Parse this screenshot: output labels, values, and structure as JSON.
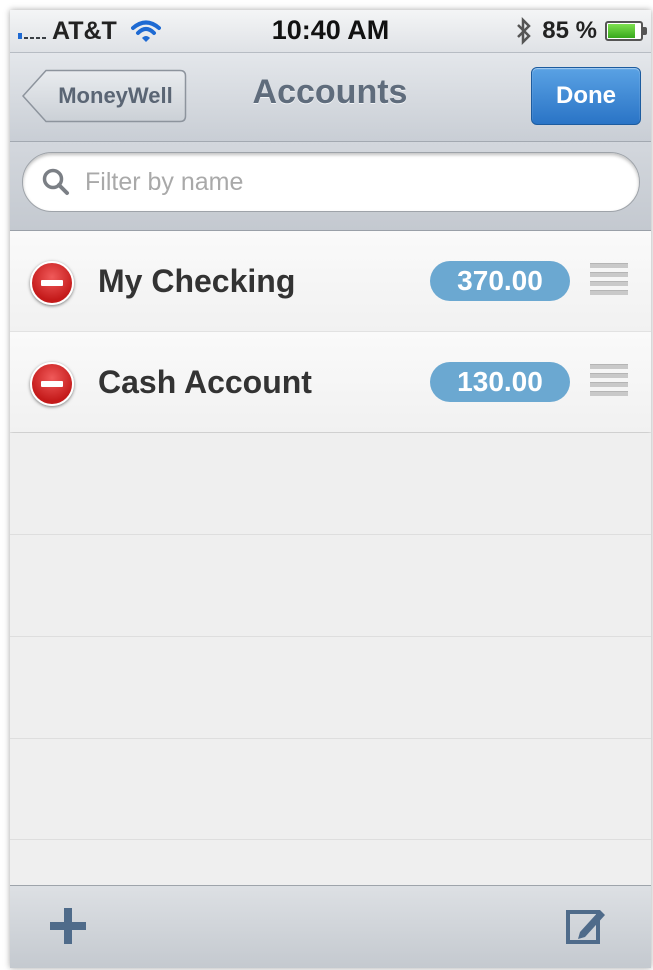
{
  "status_bar": {
    "carrier": "AT&T",
    "time": "10:40 AM",
    "battery": "85 %",
    "battery_level": 0.85,
    "wifi_icon": "wifi-icon",
    "bluetooth_icon": "bluetooth-icon"
  },
  "nav": {
    "back_label": "MoneyWell",
    "title": "Accounts",
    "done_label": "Done"
  },
  "search": {
    "placeholder": "Filter by name",
    "value": ""
  },
  "accounts": [
    {
      "name": "My Checking",
      "balance": "370.00"
    },
    {
      "name": "Cash Account",
      "balance": "130.00"
    }
  ],
  "toolbar": {
    "add_icon": "plus-icon",
    "edit_icon": "compose-icon"
  },
  "colors": {
    "badge": "#6ba8d1",
    "done": "#2a74c6",
    "delete": "#c41a1a"
  }
}
